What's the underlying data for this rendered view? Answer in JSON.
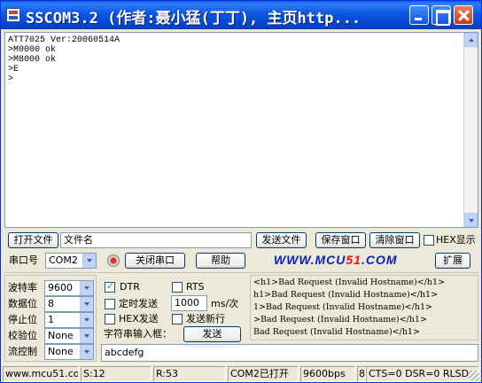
{
  "window": {
    "title": "SSCOM3.2 (作者:聂小猛(丁丁), 主页http..."
  },
  "terminal": {
    "lines": [
      "ATT7025 Ver:20060514A",
      ">M0000 ok",
      ">M8000 ok",
      ">E",
      ">"
    ]
  },
  "toolbar_row1": {
    "open_file": "打开文件",
    "file_name": "文件名",
    "send_file": "发送文件",
    "save_window": "保存窗口",
    "clear_window": "清除窗口",
    "hex_display": "HEX显示",
    "hex_display_checked": false
  },
  "toolbar_row2": {
    "port_label": "串口号",
    "port_value": "COM2",
    "close_port": "关闭串口",
    "help": "帮助",
    "website_part1": "WWW.MCU",
    "website_part2": "51",
    "website_part3": ".COM",
    "expand": "扩展"
  },
  "serial_settings": {
    "baud_label": "波特率",
    "baud_value": "9600",
    "databits_label": "数据位",
    "databits_value": "8",
    "stopbits_label": "停止位",
    "stopbits_value": "1",
    "parity_label": "校验位",
    "parity_value": "None",
    "flow_label": "流控制",
    "flow_value": "None"
  },
  "send_options": {
    "dtr_label": "DTR",
    "dtr_checked": true,
    "rts_label": "RTS",
    "rts_checked": false,
    "timed_send_label": "定时发送",
    "timed_send_checked": false,
    "interval_value": "1000",
    "interval_unit": "ms/次",
    "hex_send_label": "HEX发送",
    "hex_send_checked": false,
    "send_newline_label": "发送新行",
    "send_newline_checked": false,
    "input_label": "字符串输入框：",
    "send_button": "发送",
    "input_value": "abcdefg"
  },
  "output_panel": {
    "lines": [
      "<h1>Bad Request (Invalid Hostname)</h1>",
      "h1>Bad Request (Invalid Hostname)</h1>",
      "1>Bad Request (Invalid Hostname)</h1>",
      ">Bad Request (Invalid Hostname)</h1>",
      "Bad Request (Invalid Hostname)</h1>"
    ]
  },
  "statusbar": {
    "website": "www.mcu51.cor",
    "sent": "S:12",
    "received": "R:53",
    "port_status": "COM2已打开",
    "baud": "9600bps",
    "config": "8",
    "signals": "CTS=0 DSR=0 RLSD"
  }
}
